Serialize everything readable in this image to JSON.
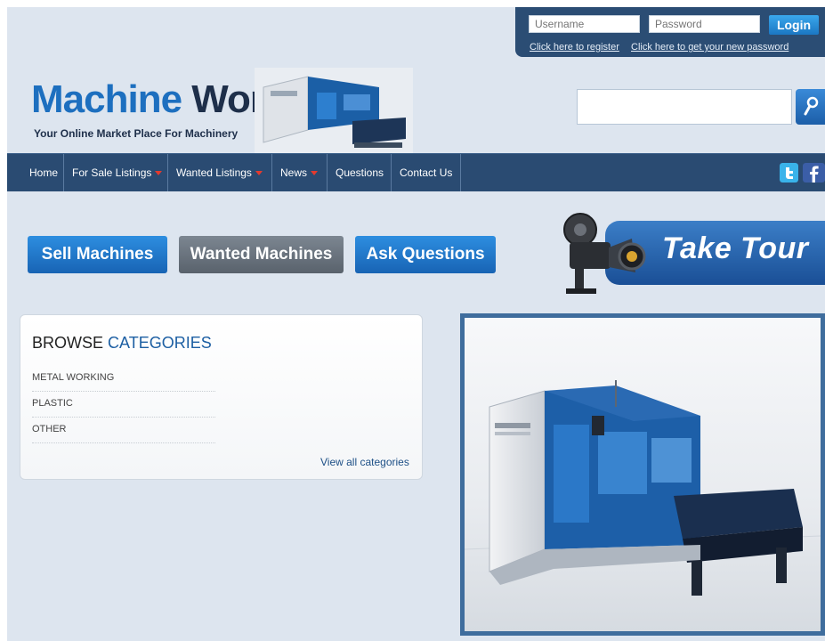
{
  "login": {
    "username_placeholder": "Username",
    "password_placeholder": "Password",
    "login_label": "Login",
    "register_link": "Click here to register",
    "forgot_link": "Click here to get your new password"
  },
  "logo": {
    "title_part1": "Machine",
    "title_part2": "World",
    "tagline": "Your Online Market Place For Machinery"
  },
  "search": {
    "value": ""
  },
  "nav": {
    "items": [
      "Home",
      "For Sale Listings",
      "Wanted Listings",
      "News",
      "Questions",
      "Contact Us"
    ]
  },
  "actions": {
    "sell": "Sell Machines",
    "wanted": "Wanted Machines",
    "ask": "Ask Questions",
    "tour": "Take Tour"
  },
  "categories": {
    "title_part1": "BROWSE",
    "title_part2": "CATEGORIES",
    "items": [
      "METAL WORKING",
      "PLASTIC",
      "OTHER"
    ],
    "view_all": "View all categories"
  },
  "icons": {
    "search": "magnifier-icon",
    "twitter": "twitter-icon",
    "facebook": "facebook-icon",
    "dropdown": "caret-down-icon",
    "camera": "film-camera-icon"
  },
  "colors": {
    "nav_bg": "#2a4b72",
    "brand_blue": "#1d6fbf",
    "brand_dark": "#1e2f4a",
    "caret_red": "#e43a2e"
  }
}
